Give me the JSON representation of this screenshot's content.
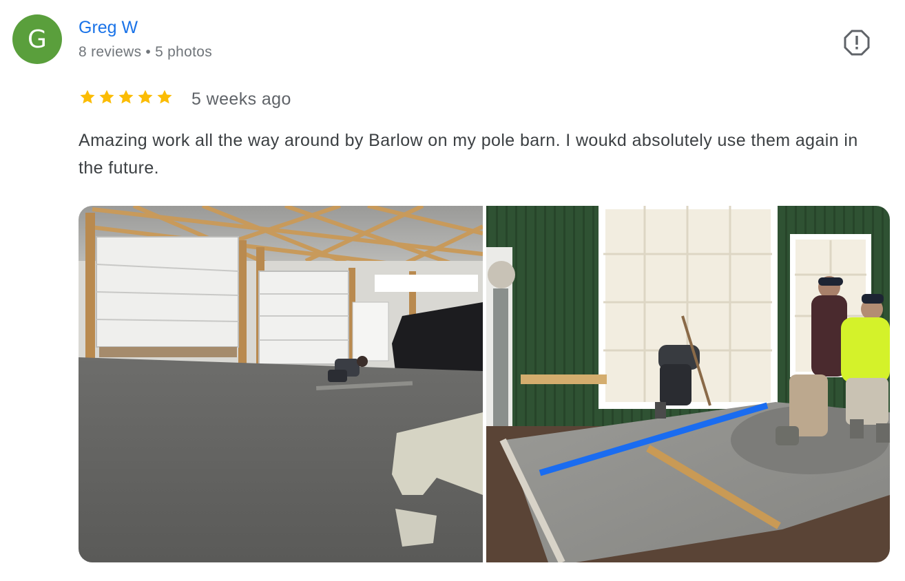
{
  "review": {
    "author": {
      "initial": "G",
      "name": "Greg W",
      "reviews": "8 reviews",
      "separator": "•",
      "photos": "5 photos"
    },
    "rating": 5,
    "time": "5 weeks ago",
    "text": "Amazing work all the way around by Barlow on my pole barn. I woukd absolutely use them again in the future.",
    "photos": [
      {
        "icon": "barn-interior-concrete-photo"
      },
      {
        "icon": "driveway-concrete-pour-photo"
      }
    ]
  },
  "colors": {
    "avatar": "#5a9f3c",
    "name": "#1a73e8",
    "star": "#fbbc04",
    "meta": "#70757a",
    "text": "#3c4043"
  }
}
